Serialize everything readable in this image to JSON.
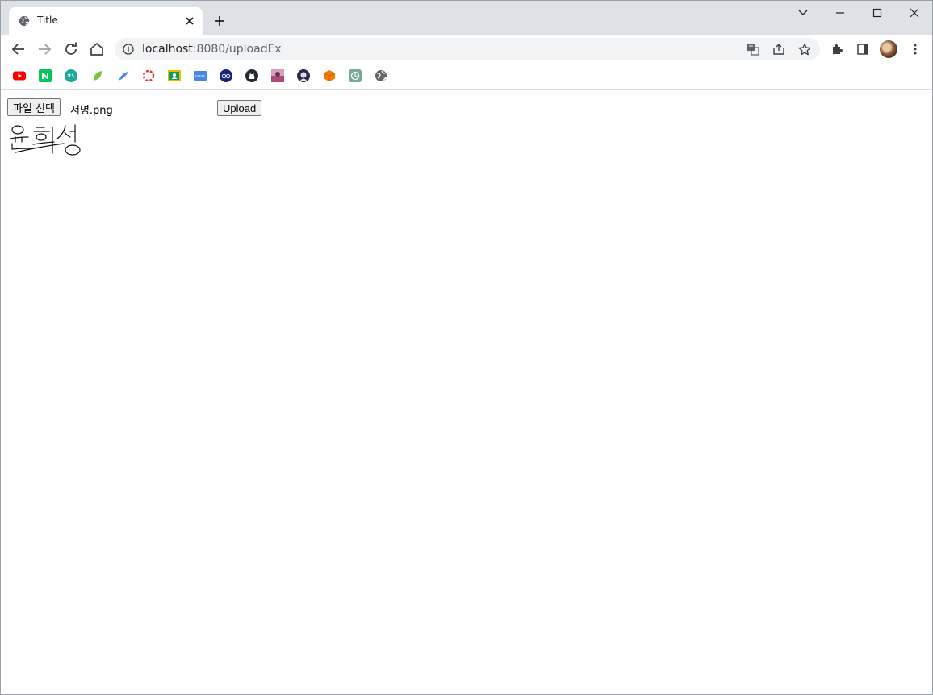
{
  "browser": {
    "tab": {
      "title": "Title",
      "favicon": "globe-icon"
    },
    "address": {
      "host": "localhost",
      "path": ":8080/uploadEx"
    },
    "bookmarks": [
      {
        "name": "youtube-bookmark",
        "color": "#ff0000"
      },
      {
        "name": "naver-bookmark",
        "color": "#03c75a"
      },
      {
        "name": "teal-bookmark",
        "color": "#1aa99a"
      },
      {
        "name": "leaf-bookmark",
        "color": "#7cc242"
      },
      {
        "name": "feather-bookmark",
        "color": "#4a90e2"
      },
      {
        "name": "ring-bookmark",
        "color": "#e53935"
      },
      {
        "name": "classroom-bookmark",
        "color": "#f4b400"
      },
      {
        "name": "calendar-bookmark",
        "color": "#4a86e8"
      },
      {
        "name": "tripadvisor-bookmark",
        "color": "#1a237e"
      },
      {
        "name": "github-bookmark",
        "color": "#24292e"
      },
      {
        "name": "photo-bookmark",
        "color": "#b04a7a"
      },
      {
        "name": "character-bookmark",
        "color": "#2c2a4a"
      },
      {
        "name": "box-bookmark",
        "color": "#f57c00"
      },
      {
        "name": "chatgpt-bookmark",
        "color": "#74aa9c"
      },
      {
        "name": "globe-bookmark",
        "color": "#5f6368"
      }
    ]
  },
  "page": {
    "file_button_label": "파일 선택",
    "file_name": "서명.png",
    "upload_button_label": "Upload"
  }
}
